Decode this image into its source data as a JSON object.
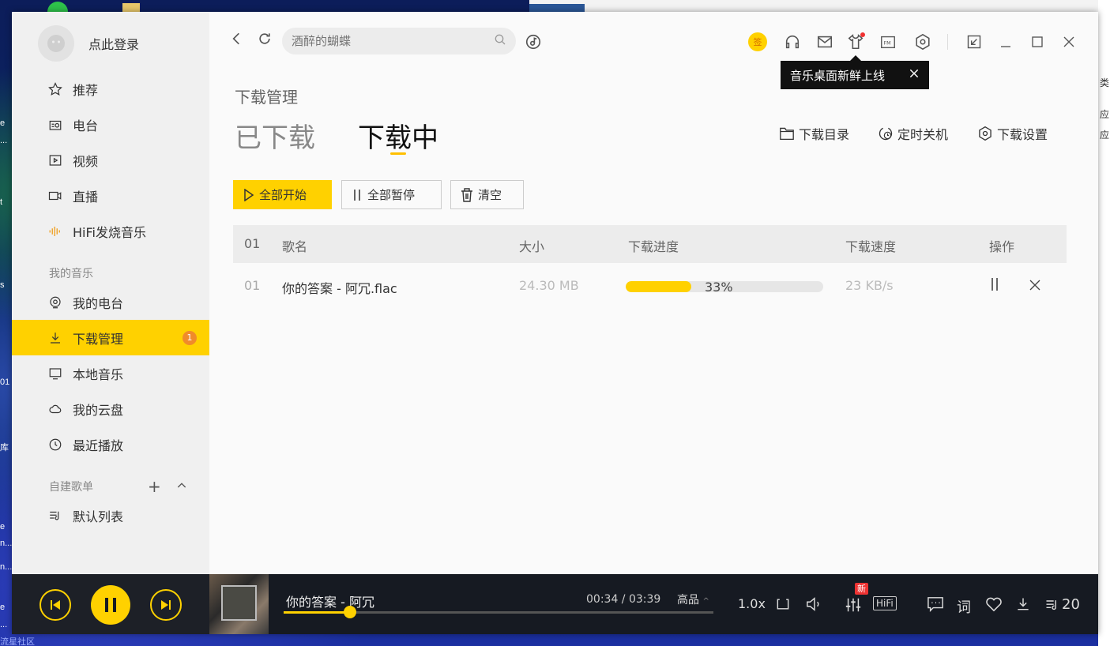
{
  "desktop": {
    "left_texts": [
      "e",
      "...",
      "t",
      "s",
      "01",
      "库",
      "e",
      "n...",
      "n...",
      "e",
      "..."
    ],
    "bottom_text": "流星社区",
    "right_texts": [
      "类",
      "应",
      "应"
    ]
  },
  "sidebar": {
    "login": "点此登录",
    "items": [
      {
        "label": "推荐",
        "icon": "star-icon"
      },
      {
        "label": "电台",
        "icon": "radio-icon"
      },
      {
        "label": "视频",
        "icon": "video-icon"
      },
      {
        "label": "直播",
        "icon": "live-camera-icon"
      },
      {
        "label": "HiFi发烧音乐",
        "icon": "soundwave-icon"
      }
    ],
    "my_music_label": "我的音乐",
    "my_music_items": [
      {
        "label": "我的电台",
        "icon": "my-radio-icon"
      },
      {
        "label": "下载管理",
        "icon": "download-icon",
        "badge": "1"
      },
      {
        "label": "本地音乐",
        "icon": "monitor-icon"
      },
      {
        "label": "我的云盘",
        "icon": "cloud-icon"
      },
      {
        "label": "最近播放",
        "icon": "clock-icon"
      }
    ],
    "playlists_label": "自建歌单",
    "playlists": [
      {
        "label": "默认列表",
        "icon": "playlist-icon"
      }
    ]
  },
  "topbar": {
    "search_placeholder": "酒醉的蝴蝶",
    "sign_label": "签",
    "tooltip": "音乐桌面新鲜上线"
  },
  "main": {
    "page_title": "下载管理",
    "tabs": [
      "已下载",
      "下载中"
    ],
    "actions": [
      "下载目录",
      "定时关机",
      "下载设置"
    ],
    "buttons": {
      "start_all": "全部开始",
      "pause_all": "全部暂停",
      "clear": "清空"
    },
    "table": {
      "headers": {
        "index": "01",
        "name": "歌名",
        "size": "大小",
        "progress": "下载进度",
        "speed": "下载速度",
        "ops": "操作"
      },
      "rows": [
        {
          "index": "01",
          "name": "你的答案 - 阿冗.flac",
          "size": "24.30 MB",
          "progress": 0.33,
          "progress_text": "33%",
          "speed": "23 KB/s"
        }
      ]
    }
  },
  "player": {
    "song": "你的答案 - 阿冗",
    "time": "00:34 / 03:39",
    "quality": "高品",
    "progress": 0.155,
    "speed": "1.0x",
    "new_badge": "新",
    "hifi": "HiFi",
    "lyrics": "词",
    "playlist_count": "20"
  },
  "colors": {
    "accent": "#ffd100",
    "player_bg": "#161a22",
    "sidebar_bg": "#f0f0f0"
  }
}
